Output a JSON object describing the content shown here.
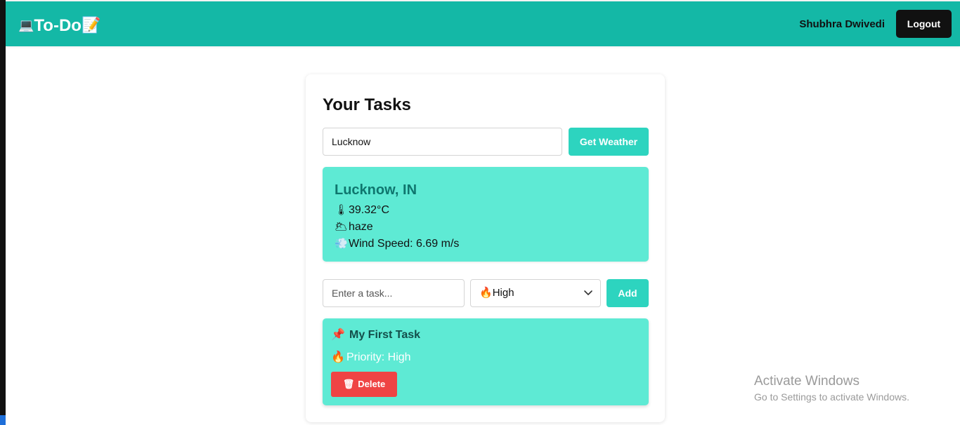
{
  "navbar": {
    "brand_icon": "💻",
    "brand_text": "To-Do",
    "brand_memo": "📝",
    "user_name": "Shubhra Dwivedi",
    "logout_label": "Logout",
    "background": "#14b8a6"
  },
  "main": {
    "title": "Your Tasks",
    "city_input_value": "Lucknow",
    "get_weather_label": "Get Weather",
    "weather": {
      "location": "Lucknow, IN",
      "temperature_icon": "🌡",
      "temperature": "39.32°C",
      "condition_icon": "🌥",
      "condition": "haze",
      "wind_icon": "💨",
      "wind_speed": "Wind Speed: 6.69 m/s"
    },
    "task_input_placeholder": "Enter a task...",
    "priority_select": {
      "icon": "🔥",
      "selected": "High"
    },
    "add_label": "Add",
    "tasks": [
      {
        "title_icon": "📌",
        "title": "My First Task",
        "priority_icon": "🔥",
        "priority": "Priority: High",
        "delete_icon": "🗑",
        "delete_label": "Delete"
      }
    ]
  },
  "watermark": {
    "title": "Activate Windows",
    "subtitle": "Go to Settings to activate Windows."
  },
  "colors": {
    "accent": "#2dd4bf",
    "card_teal": "#5eead4",
    "delete_red": "#ef4444",
    "logout_black": "#111111"
  }
}
